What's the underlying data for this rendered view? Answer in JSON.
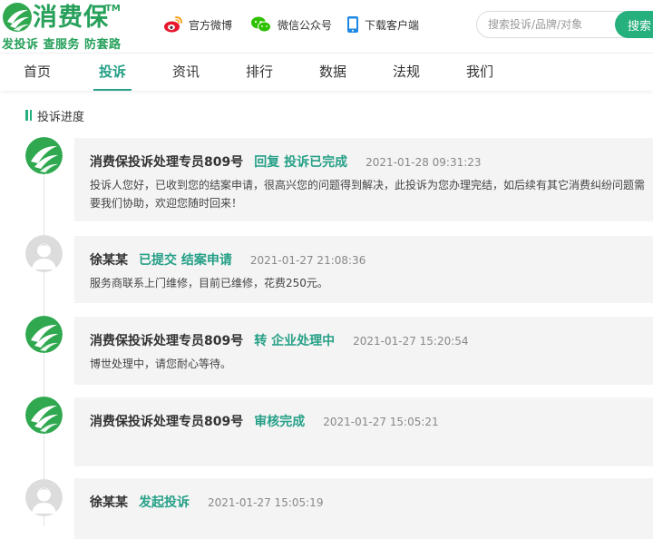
{
  "header": {
    "brand": "消费保",
    "trademark": "TM",
    "slogan": "发投诉 查服务 防套路",
    "links": {
      "weibo": "官方微博",
      "wechat": "微信公众号",
      "app": "下载客户端"
    },
    "search": {
      "placeholder": "搜索投诉/品牌/对象",
      "button": "搜索"
    }
  },
  "nav": {
    "items": [
      "首页",
      "投诉",
      "资讯",
      "排行",
      "数据",
      "法规",
      "我们"
    ],
    "active": "投诉"
  },
  "progress": {
    "title": "投诉进度",
    "entries": [
      {
        "avatar": "brand-logo",
        "author": "消费保投诉处理专员809号",
        "action": "回复 投诉已完成",
        "time": "2021-01-28 09:31:23",
        "body": "投诉人您好，已收到您的结案申请，很高兴您的问题得到解决，此投诉为您办理完结，如后续有其它消费纠纷问题需要我们协助，欢迎您随时回来！"
      },
      {
        "avatar": "user",
        "author": "徐某某",
        "action": "已提交 结案申请",
        "time": "2021-01-27 21:08:36",
        "body": "服务商联系上门维修，目前已维修，花费250元。"
      },
      {
        "avatar": "brand-logo",
        "author": "消费保投诉处理专员809号",
        "action": "转 企业处理中",
        "time": "2021-01-27 15:20:54",
        "body": "博世处理中，请您耐心等待。"
      },
      {
        "avatar": "brand-logo",
        "author": "消费保投诉处理专员809号",
        "action": "审核完成",
        "time": "2021-01-27 15:05:21",
        "body": ""
      },
      {
        "avatar": "user",
        "author": "徐某某",
        "action": "发起投诉",
        "time": "2021-01-27 15:05:19",
        "body": ""
      }
    ]
  },
  "colors": {
    "brand_green": "#26a05a",
    "accent_teal": "#26a087",
    "card_bg": "#f4f4f4"
  }
}
